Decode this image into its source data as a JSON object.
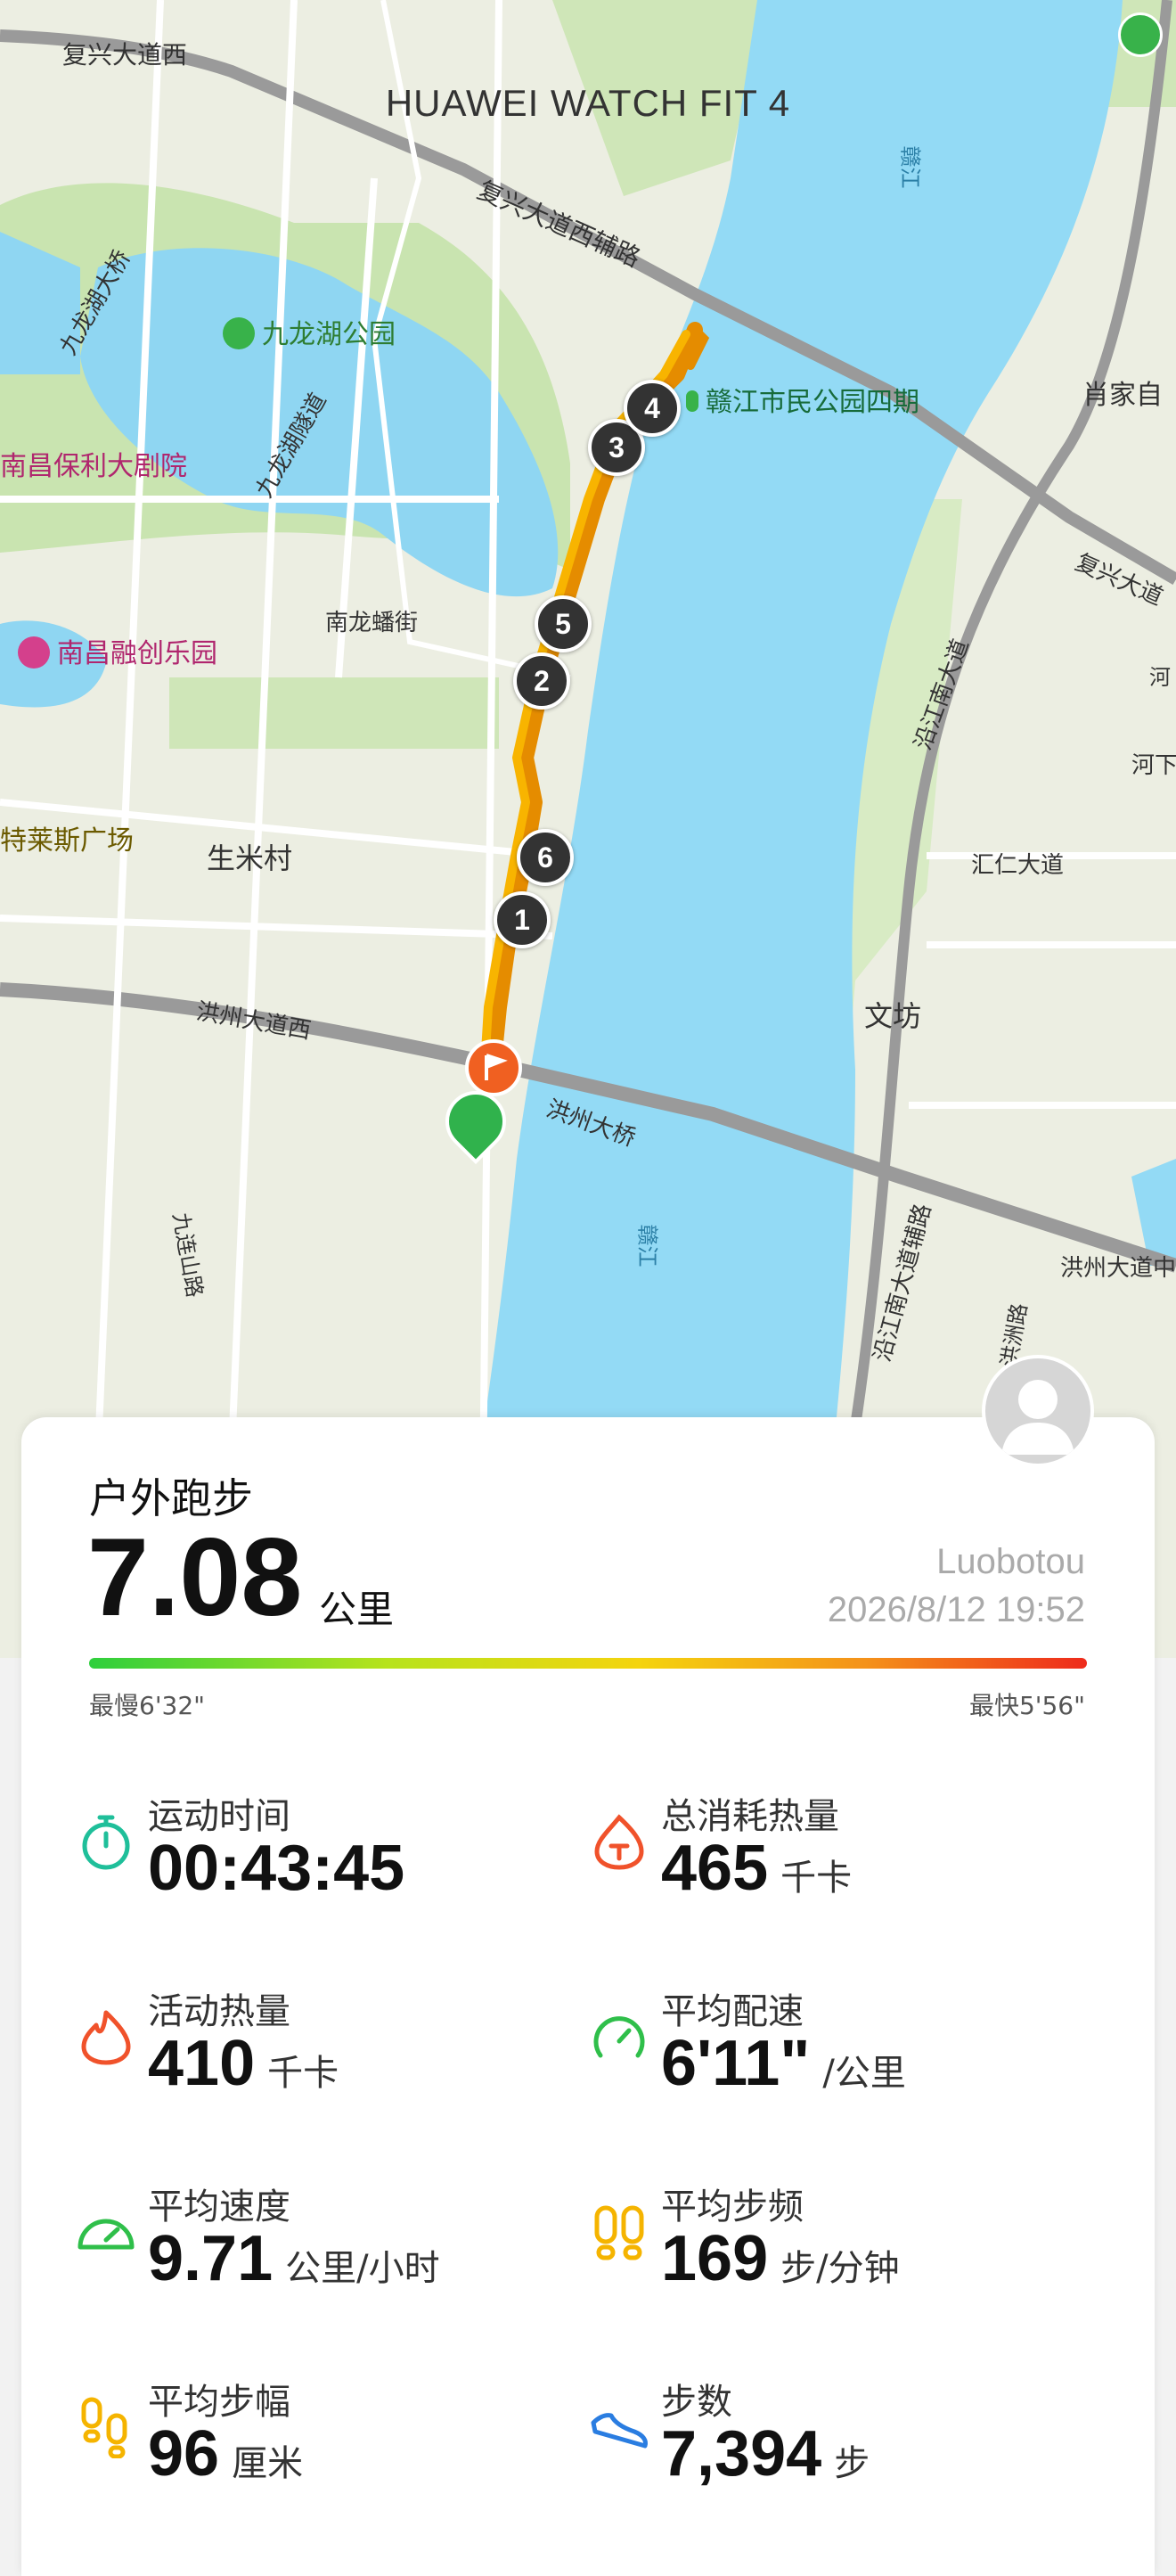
{
  "device": "HUAWEI WATCH FIT 4",
  "map": {
    "labels": {
      "fuxing_w": "复兴大道西",
      "fuxing_w_aux": "复兴大道西辅路",
      "jiulonghu_bridge": "九龙湖大桥",
      "jiulonghu_park": "九龙湖公园",
      "jiulonghu_tunnel": "九龙湖隧道",
      "poly_theater": "南昌保利大剧院",
      "nanlong": "南龙蟠街",
      "sunac": "南昌融创乐园",
      "outlet": "特莱斯广场",
      "shengmi": "生米村",
      "hongzhou_w": "洪州大道西",
      "hongzhou_bridge": "洪州大桥",
      "jiulian": "九连山路",
      "ganjiang_park": "赣江市民公园四期",
      "xiaojiaz": "肖家自",
      "fuxing_e": "复兴大道",
      "yanjiang_n": "沿江南大道",
      "yanjiang_n_aux": "沿江南大道辅路",
      "huiren": "汇仁大道",
      "wenfang": "文坊",
      "hongzhou_e": "洪州大道中",
      "ganjiang_river": "赣江",
      "ganjiang_river2": "赣江",
      "hongzhou_rd": "洪洲路",
      "he": "河",
      "hexia": "河下"
    },
    "km_markers": [
      "1",
      "2",
      "3",
      "4",
      "5",
      "6"
    ]
  },
  "activity": {
    "type": "户外跑步",
    "distance": "7.08",
    "distance_unit": "公里",
    "user": "Luobotou",
    "datetime": "2026/8/12 19:52",
    "pace_slowest": "最慢6'32\"",
    "pace_fastest": "最快5'56\""
  },
  "stats": [
    {
      "label": "运动时间",
      "value": "00:43:45",
      "unit": "",
      "icon": "stopwatch-icon",
      "color": "#1fbf9a"
    },
    {
      "label": "总消耗热量",
      "value": "465",
      "unit": "千卡",
      "icon": "calorie-total-icon",
      "color": "#f0522b"
    },
    {
      "label": "活动热量",
      "value": "410",
      "unit": "千卡",
      "icon": "flame-icon",
      "color": "#f0522b"
    },
    {
      "label": "平均配速",
      "value": "6'11\"",
      "unit": "/公里",
      "icon": "pace-gauge-icon",
      "color": "#2fbf4a"
    },
    {
      "label": "平均速度",
      "value": "9.71",
      "unit": "公里/小时",
      "icon": "speedometer-icon",
      "color": "#2fbf4a"
    },
    {
      "label": "平均步频",
      "value": "169",
      "unit": "步/分钟",
      "icon": "footprints-icon",
      "color": "#f5b400"
    },
    {
      "label": "平均步幅",
      "value": "96",
      "unit": "厘米",
      "icon": "stride-icon",
      "color": "#f5b400"
    },
    {
      "label": "步数",
      "value": "7,394",
      "unit": "步",
      "icon": "shoe-icon",
      "color": "#2a7de1"
    }
  ]
}
